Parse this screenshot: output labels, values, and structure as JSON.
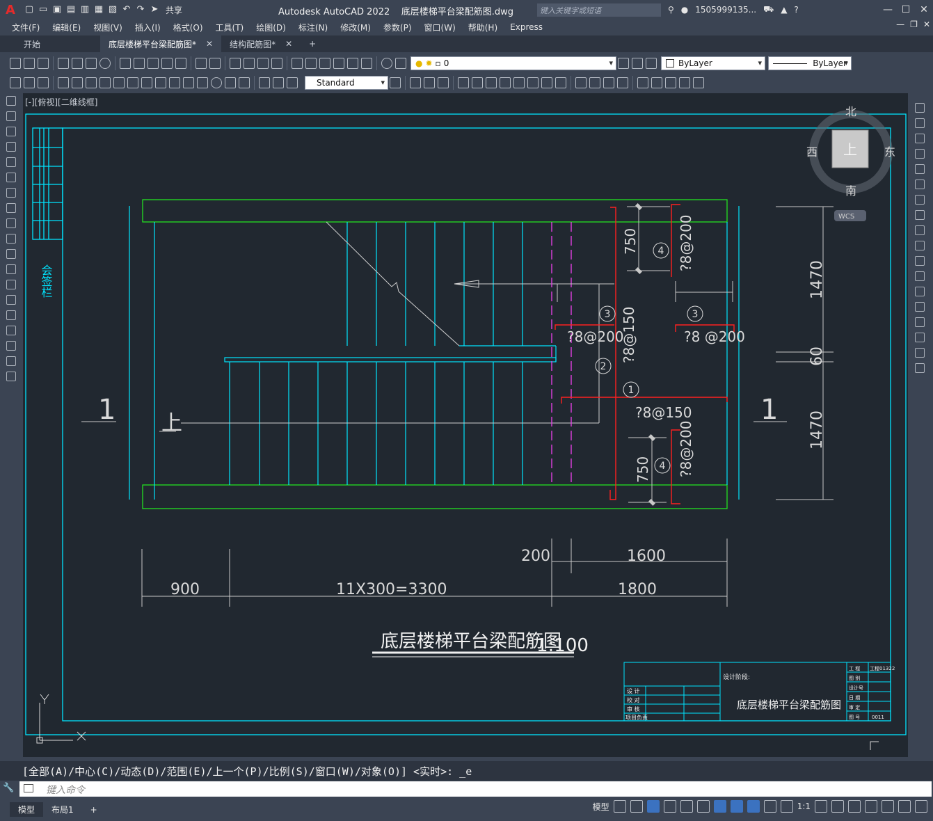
{
  "app": {
    "title": "Autodesk AutoCAD 2022",
    "filename": "底层楼梯平台梁配筋图.dwg",
    "share": "共享",
    "search_placeholder": "键入关键字或短语",
    "user": "1505999135..."
  },
  "menu": [
    "文件(F)",
    "编辑(E)",
    "视图(V)",
    "插入(I)",
    "格式(O)",
    "工具(T)",
    "绘图(D)",
    "标注(N)",
    "修改(M)",
    "参数(P)",
    "窗口(W)",
    "帮助(H)",
    "Express"
  ],
  "tabs": [
    {
      "label": "开始",
      "active": false,
      "closable": false
    },
    {
      "label": "底层楼梯平台梁配筋图*",
      "active": true,
      "closable": true
    },
    {
      "label": "结构配筋图*",
      "active": false,
      "closable": true
    }
  ],
  "toolbar": {
    "layer_value": "0",
    "color_value": "ByLayer",
    "linetype_value": "ByLayer",
    "textstyle_value": "Standard"
  },
  "viewport": {
    "label": "[-][俯视][二维线框]",
    "viewcube": {
      "north": "北",
      "south": "南",
      "east": "东",
      "west": "西",
      "top": "上",
      "wcs": "WCS"
    }
  },
  "drawing": {
    "sign_column": "会签栏",
    "section_mark": "1",
    "up_label": "上",
    "dims": {
      "d750": "750",
      "d1470": "1470",
      "d60": "60",
      "d200": "200",
      "d1600": "1600",
      "d900": "900",
      "d3300": "11X300=3300",
      "d1800": "1800"
    },
    "markers": {
      "m1": "1",
      "m2": "2",
      "m3": "3",
      "m4": "4"
    },
    "rebar": {
      "r200": "?8@200",
      "r150": "?8@150",
      "r200b": "?8 @200"
    },
    "title": "底层楼梯平台梁配筋图",
    "scale": "1:100",
    "titleblock": {
      "project": "设计阶段:",
      "name": "底层楼梯平台梁配筋图",
      "rows": [
        "设 计",
        "校 对",
        "审 核",
        "项目负责"
      ],
      "right_labels": [
        "工 程",
        "图 别",
        "设计号",
        "日 期",
        "审 定",
        "图 号"
      ],
      "right_values": [
        "工程01322",
        "",
        "",
        "",
        "",
        "0011"
      ]
    }
  },
  "command": {
    "history": "[全部(A)/中心(C)/动态(D)/范围(E)/上一个(P)/比例(S)/窗口(W)/对象(O)] <实时>: _e",
    "placeholder": "键入命令"
  },
  "layouts": [
    {
      "label": "模型",
      "active": true
    },
    {
      "label": "布局1",
      "active": false
    }
  ],
  "status": {
    "model": "模型",
    "scale": "1:1"
  }
}
